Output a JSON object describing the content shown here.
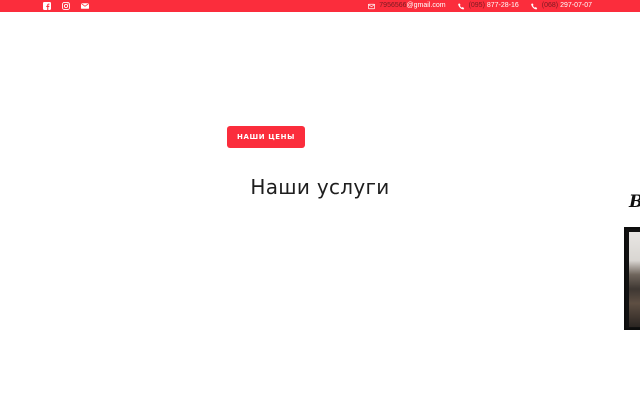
{
  "topbar": {
    "social": [
      {
        "icon": "facebook-icon"
      },
      {
        "icon": "instagram-icon"
      },
      {
        "icon": "envelope-icon"
      }
    ],
    "email": {
      "icon": "envelope-icon",
      "part1": "7956566",
      "part2": "@gmail.com"
    },
    "phone1": {
      "icon": "phone-icon",
      "part1": "(095)",
      "part2": "877-28-16"
    },
    "phone2": {
      "icon": "phone-icon",
      "part1": "(068)",
      "part2": "297-07-07"
    },
    "colors": {
      "bar": "#fb2d3c",
      "text": "#ffffff",
      "muted": "#7a1a22"
    }
  },
  "hero": {
    "prices_button": "НАШИ ЦЕНЫ"
  },
  "services": {
    "title": "Наши услуги"
  },
  "right_edge": {
    "letter": "В"
  }
}
